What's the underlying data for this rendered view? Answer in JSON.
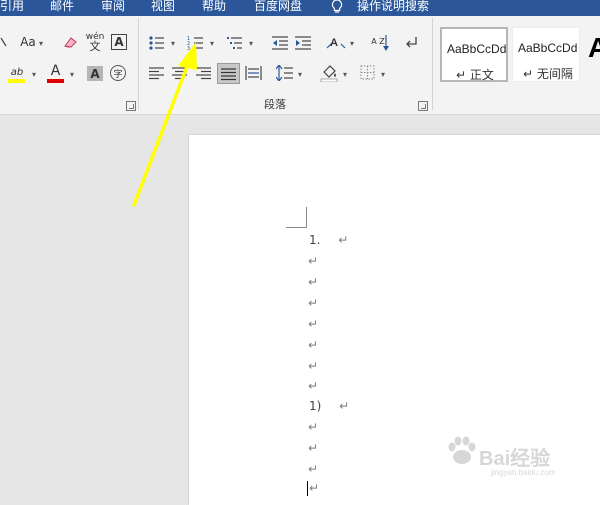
{
  "menu_tabs": [
    "引用",
    "邮件",
    "审阅",
    "视图",
    "帮助",
    "百度网盘",
    "操作说明搜索"
  ],
  "ribbon": {
    "font_group": {
      "change_case": "Aa",
      "phonetic": "wén",
      "phonetic_char": "文",
      "border_char": "A",
      "highlight": "ab",
      "font_color": "A",
      "shading_char": "A",
      "enclose_char": "字"
    },
    "paragraph_group": {
      "label": "段落",
      "sort_letters": "A Z"
    },
    "styles": [
      {
        "preview": "AaBbCcDd",
        "name": "正文",
        "selected": true
      },
      {
        "preview": "AaBbCcDd",
        "name": "无间隔",
        "selected": false
      }
    ],
    "style_next_preview": "A"
  },
  "document": {
    "paragraph_mark": "↵",
    "lines": [
      {
        "number": "1.",
        "text": ""
      },
      {
        "number": "",
        "text": ""
      },
      {
        "number": "",
        "text": ""
      },
      {
        "number": "",
        "text": ""
      },
      {
        "number": "",
        "text": ""
      },
      {
        "number": "",
        "text": ""
      },
      {
        "number": "",
        "text": ""
      },
      {
        "number": "",
        "text": ""
      },
      {
        "number": "1)",
        "text": ""
      },
      {
        "number": "",
        "text": ""
      },
      {
        "number": "",
        "text": ""
      },
      {
        "number": "",
        "text": ""
      },
      {
        "number": "",
        "text": ""
      }
    ]
  },
  "watermark": {
    "text": "Bai经验",
    "url": "jingyan.baidu.com"
  },
  "colors": {
    "tabbar": "#2b579a",
    "highlight_bar": "#ffff00",
    "font_color_bar": "#e00000",
    "arrow": "#ffff00"
  }
}
